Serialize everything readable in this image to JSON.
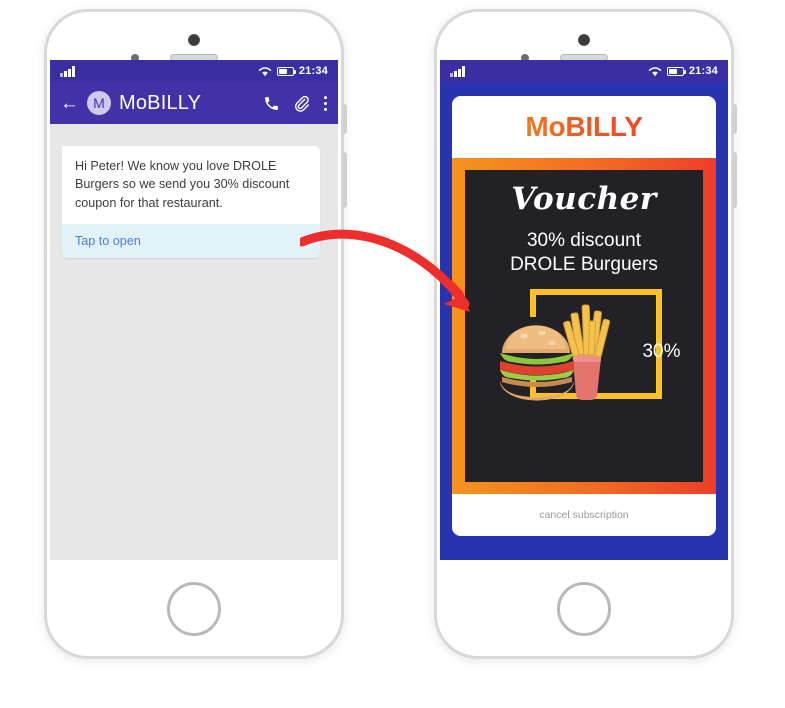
{
  "left_phone": {
    "status_bar": {
      "time": "21:34",
      "signal_icon": "signal-bars-icon",
      "wifi_icon": "wifi-icon",
      "battery_icon": "battery-icon"
    },
    "app_bar": {
      "back_icon": "back-arrow-icon",
      "avatar_initial": "M",
      "title": "MoBILLY",
      "call_icon": "phone-icon",
      "attach_icon": "paperclip-icon",
      "overflow_icon": "more-vertical-icon"
    },
    "message": {
      "text": "Hi Peter! We know you love DROLE Burgers so we send you 30% discount coupon for that restaurant.",
      "action_label": "Tap to open"
    },
    "composer": {
      "emoji_icon": "smiley-icon",
      "input_value": "",
      "camera_icon": "camera-icon",
      "mic_icon": "microphone-icon"
    }
  },
  "right_phone": {
    "status_bar": {
      "time": "21:34",
      "signal_icon": "signal-bars-icon",
      "wifi_icon": "wifi-icon",
      "battery_icon": "battery-icon"
    },
    "card": {
      "logo": "MoBILLY",
      "voucher_title": "Voucher",
      "discount_line": "30% discount",
      "merchant_line": "DROLE Burguers",
      "badge_percent": "30%",
      "food_image": "burger-and-fries-image",
      "footer_link": "cancel subscription"
    }
  },
  "annotation": {
    "arrow_icon": "curved-arrow-icon"
  },
  "colors": {
    "status_purple": "#3a2ea3",
    "appbar_purple": "#4331a8",
    "chat_bg": "#e7e7e7",
    "action_bg": "#e3f1f9",
    "action_text": "#4a7ce8",
    "mic_purple": "#4a21c6",
    "campaign_blue": "#2833b0",
    "gradient_orange": "#F5941F",
    "gradient_red": "#ED3E2A",
    "voucher_dark": "#222226",
    "frame_yellow": "#FFC222",
    "arrow_red": "#EE2D2D"
  }
}
